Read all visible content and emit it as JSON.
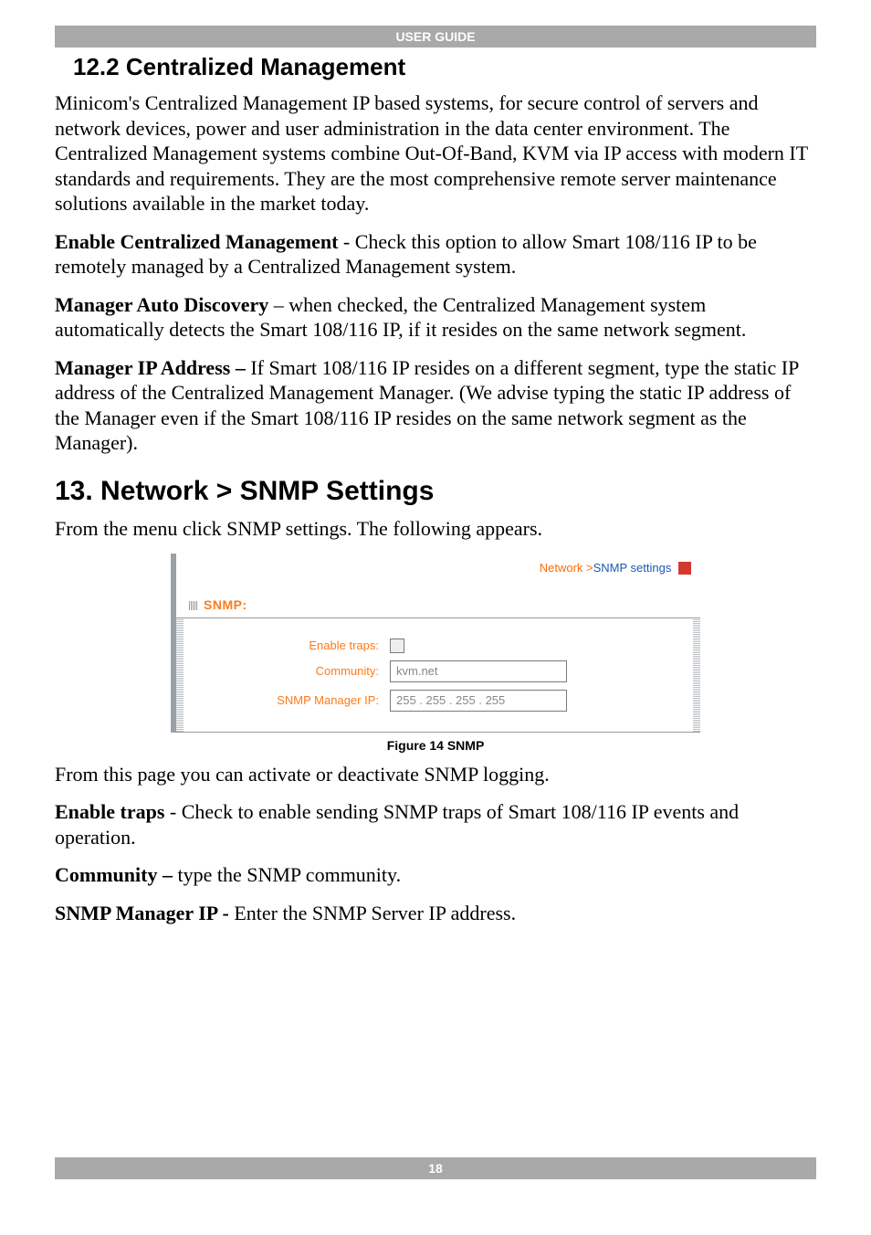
{
  "header": {
    "title": "USER GUIDE"
  },
  "footer": {
    "page_number": "18"
  },
  "section_12_2": {
    "heading": "12.2 Centralized Management",
    "p1": "Minicom's Centralized Management IP based systems, for secure control of servers and network devices, power and user administration in the data center environment. The Centralized Management systems combine Out-Of-Band, KVM via IP access with modern IT standards and requirements. They are the most comprehensive remote server maintenance solutions available in the market today.",
    "p2_lead": "Enable Centralized Management",
    "p2_rest": " - Check this option to allow Smart 108/116 IP to be remotely managed by a Centralized Management system.",
    "p3_lead": "Manager Auto Discovery",
    "p3_rest": " – when checked, the Centralized Management system automatically detects the Smart 108/116 IP, if it resides on the same network segment.",
    "p4_lead": "Manager IP Address –",
    "p4_rest": " If Smart 108/116 IP resides on a different segment, type the static IP address of the Centralized Management Manager. (We advise typing the static IP address of the Manager even if the Smart 108/116 IP resides on the same network segment as the Manager)."
  },
  "section_13": {
    "heading": "13. Network > SNMP Settings",
    "intro": "From the menu click SNMP settings. The following appears.",
    "post": "From this page you can activate or deactivate SNMP logging.",
    "p1_lead": "Enable traps",
    "p1_rest": " - Check to enable sending SNMP traps of Smart 108/116 IP events and operation.",
    "p2_lead": "Community –",
    "p2_rest": " type the SNMP community.",
    "p3_lead": "SNMP Manager IP -",
    "p3_rest": " Enter the SNMP Server IP address."
  },
  "figure": {
    "caption": "Figure 14 SNMP",
    "breadcrumb": {
      "network": "Network >",
      "page": "SNMP settings"
    },
    "panel_title": "SNMP:",
    "labels": {
      "enable_traps": "Enable traps:",
      "community": "Community:",
      "manager_ip": "SNMP Manager IP:"
    },
    "values": {
      "enable_traps_checked": false,
      "community": "kvm.net",
      "manager_ip": "255 . 255 . 255 . 255"
    }
  }
}
